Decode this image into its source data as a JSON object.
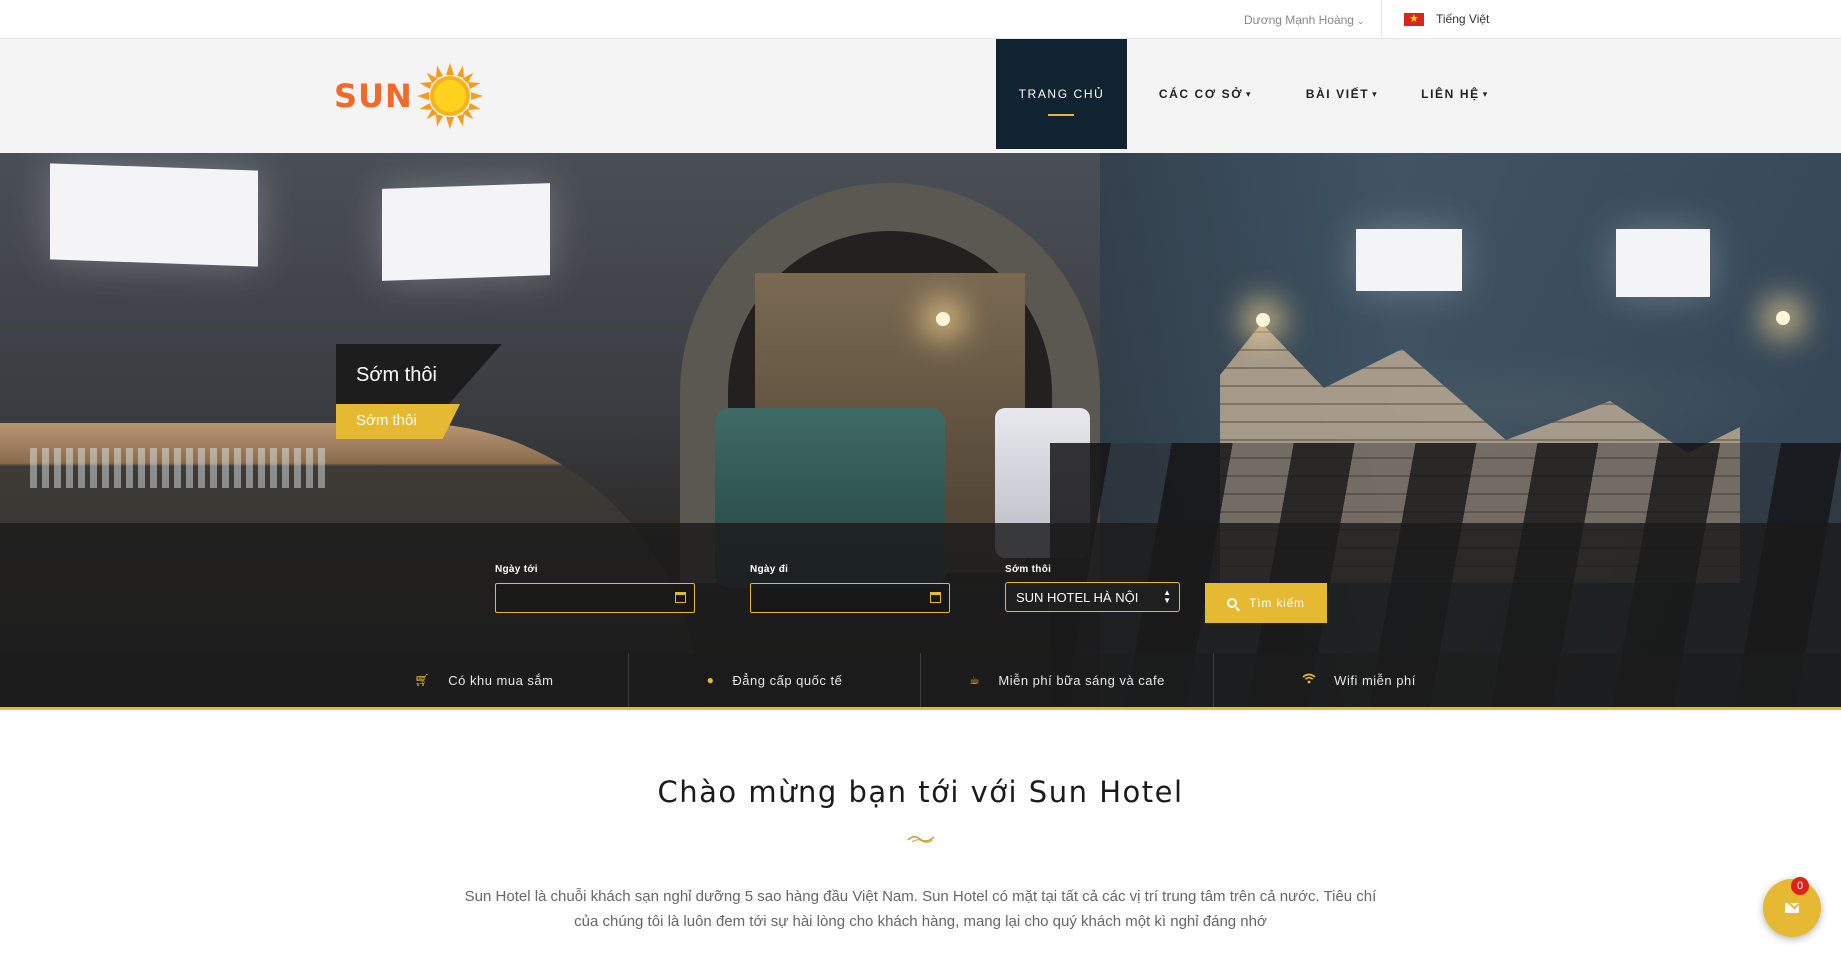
{
  "topbar": {
    "user_name": "Dương Mạnh Hoàng",
    "language": "Tiếng Việt",
    "language_flag": "vietnam-flag"
  },
  "header": {
    "logo_text": "SUN",
    "nav": [
      {
        "label": "TRANG CHỦ",
        "active": true
      },
      {
        "label": "CÁC CƠ SỞ",
        "has_dropdown": true
      },
      {
        "label": "BÀI VIẾT",
        "has_dropdown": true
      },
      {
        "label": "LIÊN HỆ",
        "has_dropdown": true
      }
    ]
  },
  "hero": {
    "caption_title": "Sớm thôi",
    "caption_subtitle": "Sớm thôi"
  },
  "booking": {
    "arrival_label": "Ngày tới",
    "arrival_value": "",
    "departure_label": "Ngày đi",
    "departure_value": "",
    "hotel_label": "Sớm thôi",
    "hotel_selected": "SUN HOTEL HÀ NỘI",
    "search_label": "Tìm kiếm"
  },
  "amenities": [
    {
      "icon": "cart-icon",
      "label": "Có khu mua sắm"
    },
    {
      "icon": "globe-icon",
      "label": "Đẳng cấp quốc tế"
    },
    {
      "icon": "coffee-icon",
      "label": "Miễn phí bữa sáng và cafe"
    },
    {
      "icon": "wifi-icon",
      "label": "Wifi miễn phí"
    }
  ],
  "welcome": {
    "title": "Chào mừng bạn tới với Sun Hotel",
    "text": "Sun Hotel là chuỗi khách sạn nghỉ dưỡng 5 sao hàng đầu Việt Nam. Sun Hotel có mặt tại tất cả các vị trí trung tâm trên cả nước. Tiêu chí của chúng tôi là luôn đem tới sự hài lòng cho khách hàng, mang lại cho quý khách một kì nghỉ đáng nhớ"
  },
  "chat": {
    "badge_count": "0"
  },
  "colors": {
    "accent": "#e6b933",
    "nav_active": "#0f2331",
    "logo": "#f26a2b"
  }
}
